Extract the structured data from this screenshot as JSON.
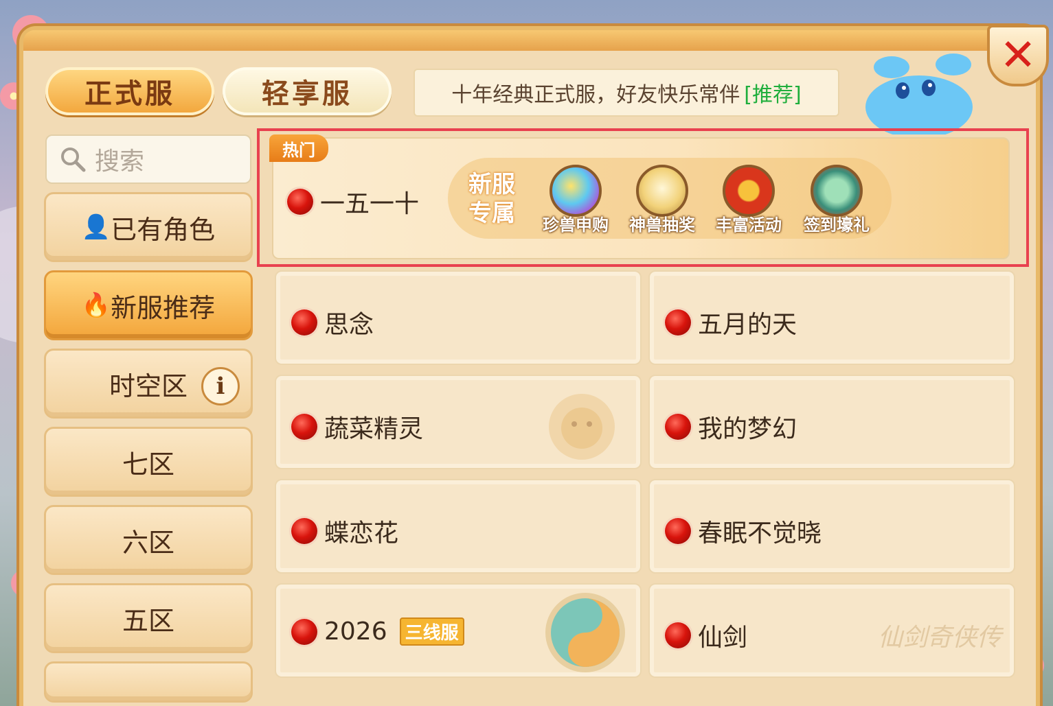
{
  "tabs": {
    "formal": "正式服",
    "light": "轻享服"
  },
  "slogan": {
    "text": "十年经典正式服，好友快乐常伴",
    "recommend": "[推荐]"
  },
  "search": {
    "placeholder": "搜索"
  },
  "sidebar": {
    "items": [
      {
        "label": "已有角色"
      },
      {
        "label": "新服推荐"
      },
      {
        "label": "时空区"
      },
      {
        "label": "七区"
      },
      {
        "label": "六区"
      },
      {
        "label": "五区"
      }
    ]
  },
  "hot": {
    "badge": "热门",
    "server_name": "一五一十",
    "perks_title": "新服专属",
    "perks": [
      {
        "label": "珍兽申购"
      },
      {
        "label": "神兽抽奖"
      },
      {
        "label": "丰富活动"
      },
      {
        "label": "签到壕礼"
      }
    ]
  },
  "servers": [
    {
      "name": "思念"
    },
    {
      "name": "五月的天"
    },
    {
      "name": "蔬菜精灵"
    },
    {
      "name": "我的梦幻"
    },
    {
      "name": "蝶恋花"
    },
    {
      "name": "春眠不觉晓"
    },
    {
      "name": "2026",
      "tag": "三线服"
    },
    {
      "name": "仙剑",
      "watermark": "仙剑奇侠传"
    }
  ],
  "colors": {
    "accent": "#f2a53a",
    "highlight_border": "#e8414f",
    "status_dot": "#d8140c",
    "recommend": "#1fae3c"
  }
}
